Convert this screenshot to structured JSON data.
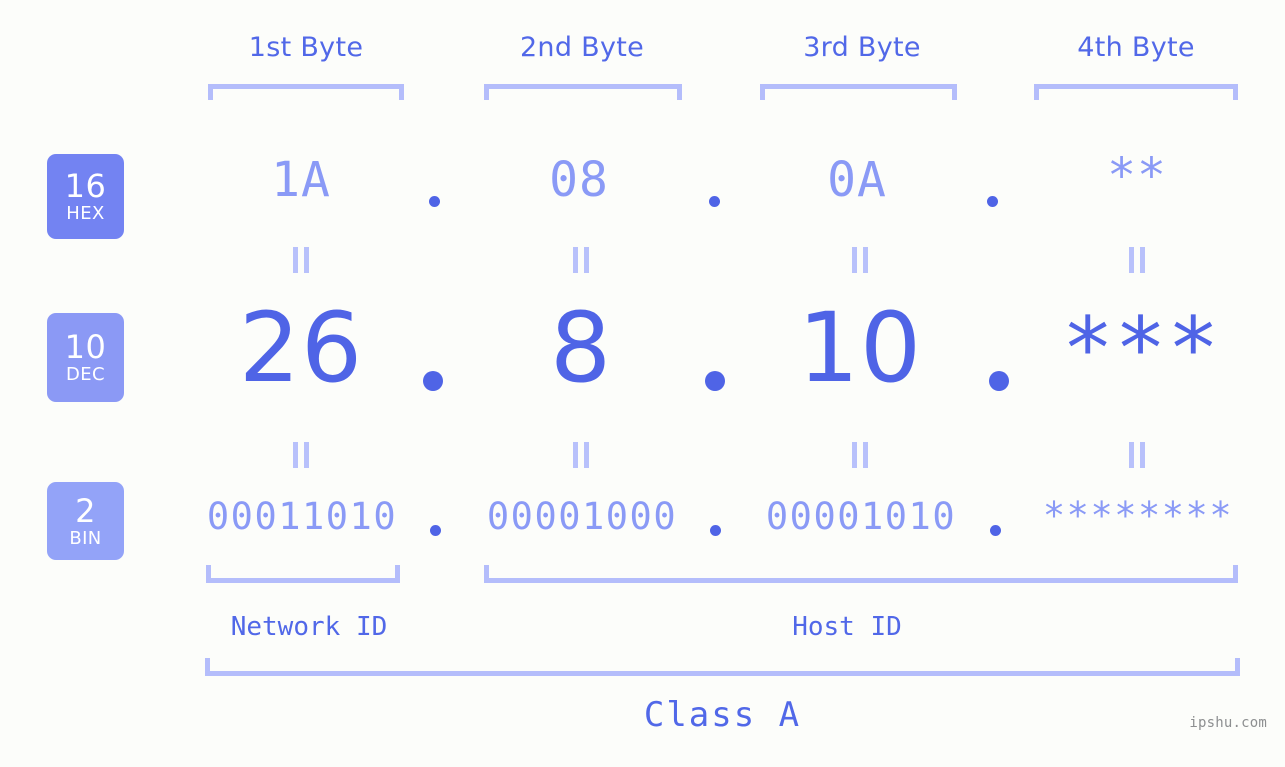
{
  "meta": {
    "watermark": "ipshu.com",
    "background_color": "#fcfdfa",
    "accent_dark": "#4f64e6",
    "accent_mid": "#5168e8",
    "accent_light": "#8a9af6",
    "bracket_color": "#b4bdfb"
  },
  "byte_headers": [
    {
      "label": "1st Byte"
    },
    {
      "label": "2nd Byte"
    },
    {
      "label": "3rd Byte"
    },
    {
      "label": "4th Byte"
    }
  ],
  "bases": [
    {
      "number": "16",
      "name": "HEX",
      "color": "#7383f2"
    },
    {
      "number": "10",
      "name": "DEC",
      "color": "#8b99f5"
    },
    {
      "number": "2",
      "name": "BIN",
      "color": "#93a3f8"
    }
  ],
  "rows": {
    "hex": {
      "base_number": "16",
      "base_name": "HEX",
      "values": [
        "1A",
        "08",
        "0A",
        "**"
      ],
      "separator": "."
    },
    "dec": {
      "base_number": "10",
      "base_name": "DEC",
      "values": [
        "26",
        "8",
        "10",
        "***"
      ],
      "separator": "."
    },
    "bin": {
      "base_number": "2",
      "base_name": "BIN",
      "values": [
        "00011010",
        "00001000",
        "00001010",
        "********"
      ],
      "separator": "."
    }
  },
  "equals_marker": "=",
  "segments": {
    "network_id": "Network ID",
    "host_id": "Host ID",
    "class": "Class A"
  }
}
